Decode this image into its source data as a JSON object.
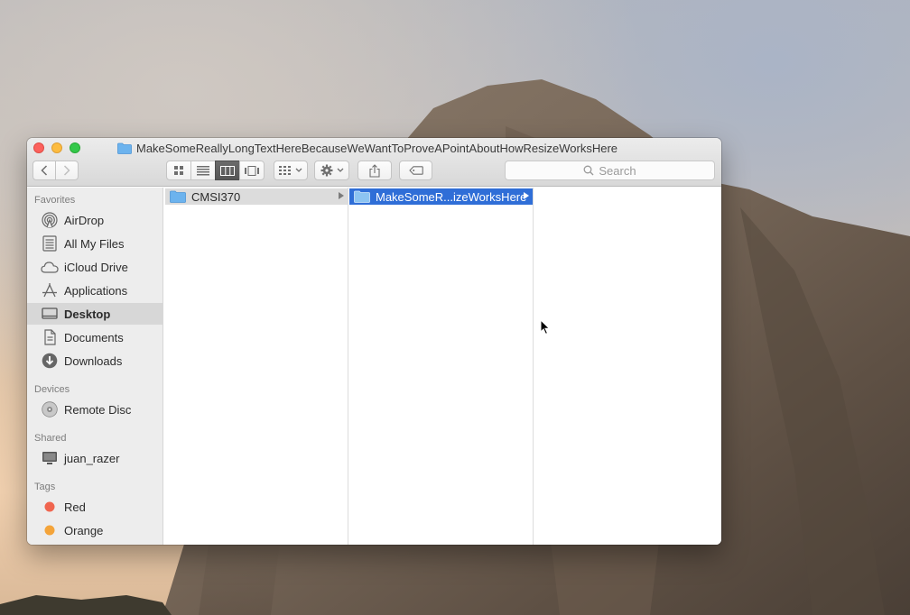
{
  "window": {
    "title": "MakeSomeReallyLongTextHereBecauseWeWantToProveAPointAboutHowResizeWorksHere"
  },
  "toolbar": {
    "back_icon": "chevron-left-icon",
    "forward_icon": "chevron-right-icon",
    "view_modes": [
      "icon-view",
      "list-view",
      "column-view",
      "cover-flow-view"
    ],
    "active_view": "column-view",
    "search_placeholder": "Search"
  },
  "sidebar": {
    "favorites_header": "Favorites",
    "favorites": [
      {
        "label": "AirDrop",
        "icon": "airdrop-icon"
      },
      {
        "label": "All My Files",
        "icon": "all-files-icon"
      },
      {
        "label": "iCloud Drive",
        "icon": "cloud-icon"
      },
      {
        "label": "Applications",
        "icon": "applications-icon"
      },
      {
        "label": "Desktop",
        "icon": "desktop-icon",
        "selected": true
      },
      {
        "label": "Documents",
        "icon": "documents-icon"
      },
      {
        "label": "Downloads",
        "icon": "downloads-icon"
      }
    ],
    "devices_header": "Devices",
    "devices": [
      {
        "label": "Remote Disc",
        "icon": "disc-icon"
      }
    ],
    "shared_header": "Shared",
    "shared": [
      {
        "label": "juan_razer",
        "icon": "computer-icon"
      }
    ],
    "tags_header": "Tags",
    "tags": [
      {
        "label": "Red",
        "color": "#f0654f"
      },
      {
        "label": "Orange",
        "color": "#f4a43a"
      }
    ]
  },
  "columns": {
    "col1": [
      {
        "label": "CMSI370",
        "type": "folder",
        "has_children": true
      }
    ],
    "col2": [
      {
        "label": "MakeSomeR...izeWorksHere",
        "type": "folder",
        "has_children": true,
        "selected": true
      }
    ],
    "col3": []
  },
  "colors": {
    "selection_blue": "#2f6ed7",
    "folder_blue": "#6cb3ee"
  }
}
